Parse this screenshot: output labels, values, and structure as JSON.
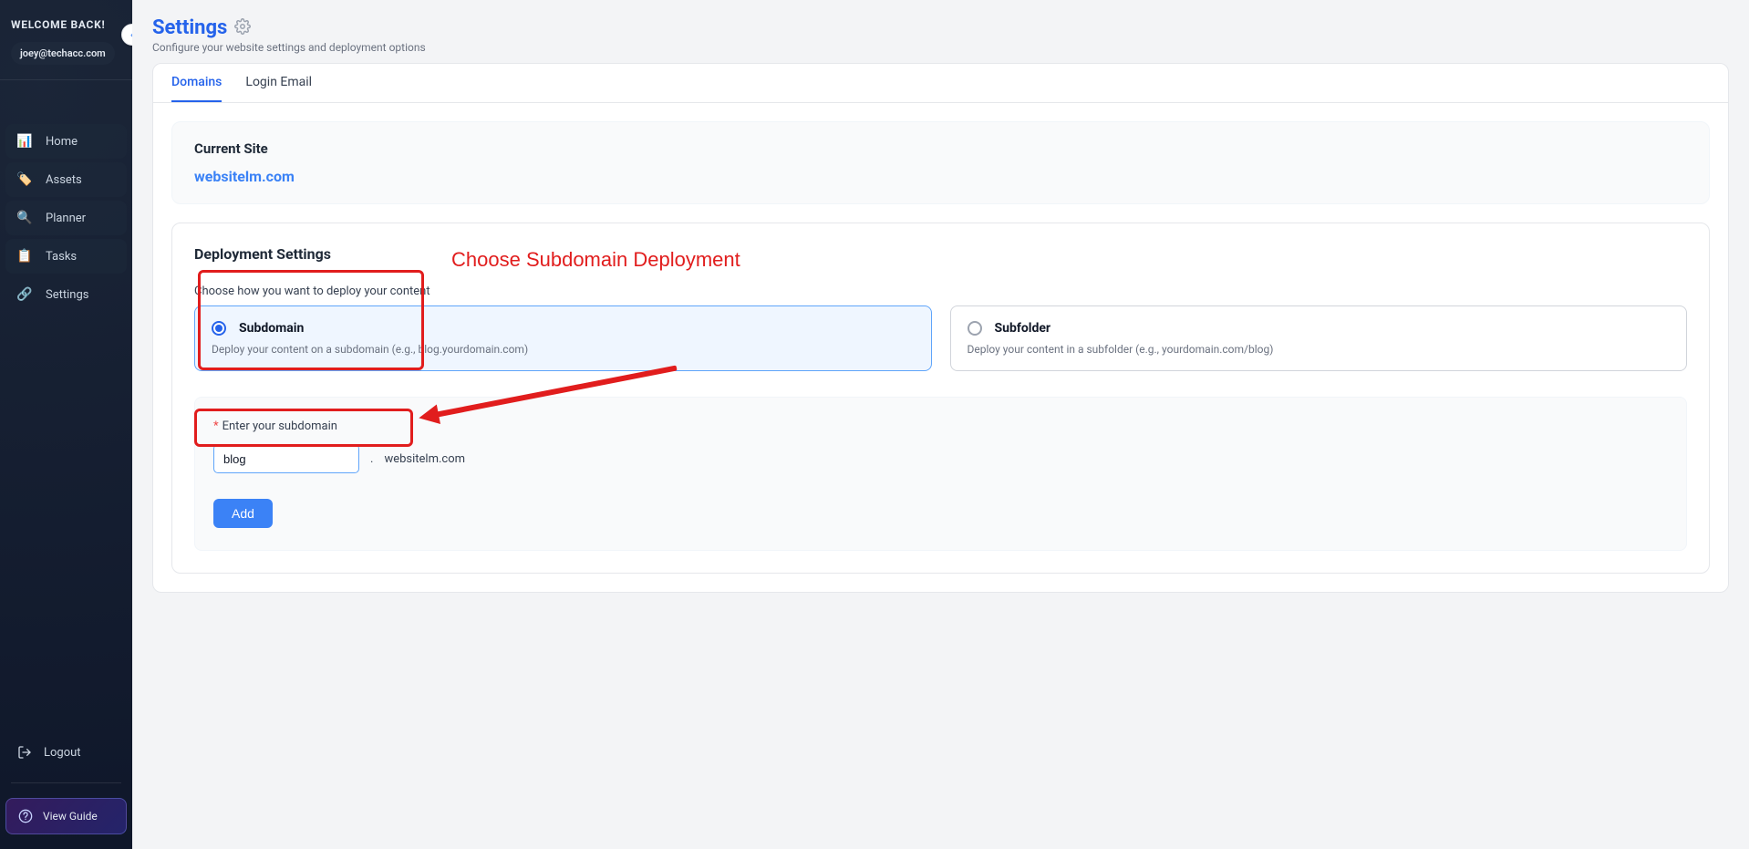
{
  "sidebar": {
    "welcome": "WELCOME BACK!",
    "email": "joey@techacc.com",
    "items": [
      {
        "icon": "📊",
        "label": "Home"
      },
      {
        "icon": "🏷️",
        "label": "Assets"
      },
      {
        "icon": "🔍",
        "label": "Planner"
      },
      {
        "icon": "📋",
        "label": "Tasks"
      },
      {
        "icon": "🔗",
        "label": "Settings"
      }
    ],
    "logout_label": "Logout",
    "view_guide_label": "View Guide"
  },
  "header": {
    "title": "Settings",
    "subtitle": "Configure your website settings and deployment options"
  },
  "tabs": [
    {
      "label": "Domains",
      "active": true
    },
    {
      "label": "Login Email",
      "active": false
    }
  ],
  "current_site": {
    "title": "Current Site",
    "domain": "websitelm.com"
  },
  "deployment": {
    "title": "Deployment Settings",
    "hint": "Choose how you want to deploy your content",
    "options": [
      {
        "key": "subdomain",
        "label": "Subdomain",
        "desc": "Deploy your content on a subdomain (e.g., blog.yourdomain.com)",
        "selected": true
      },
      {
        "key": "subfolder",
        "label": "Subfolder",
        "desc": "Deploy your content in a subfolder (e.g., yourdomain.com/blog)",
        "selected": false
      }
    ],
    "form": {
      "label": "Enter your subdomain",
      "value": "blog",
      "suffix": "websitelm.com",
      "dot": ".",
      "add_label": "Add"
    }
  },
  "annotations": {
    "callout_text": "Choose Subdomain Deployment"
  }
}
